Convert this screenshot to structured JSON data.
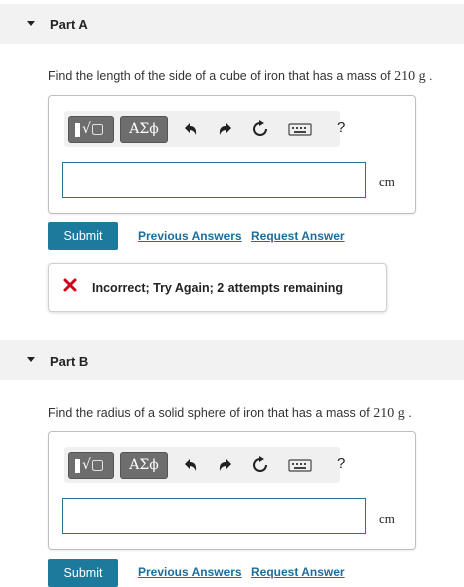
{
  "part_a": {
    "label": "Part A",
    "question_text": "Find the length of the side of a cube of iron that has a mass of",
    "mass": "210 g",
    "end": ".",
    "toolbar": {
      "math_button": "√▢",
      "greek_button": "ΑΣϕ",
      "help": "?"
    },
    "unit": "cm",
    "submit_label": "Submit",
    "previous_answers": "Previous Answers",
    "request_answer": "Request Answer",
    "feedback": "Incorrect; Try Again; 2 attempts remaining"
  },
  "part_b": {
    "label": "Part B",
    "question_text": "Find the radius of a solid sphere of iron that has a mass of",
    "mass": "210 g",
    "end": ".",
    "toolbar": {
      "math_button": "√▢",
      "greek_button": "ΑΣϕ",
      "help": "?"
    },
    "unit": "cm",
    "submit_label": "Submit",
    "previous_answers": "Previous Answers",
    "request_answer": "Request Answer"
  },
  "colors": {
    "accent": "#1c7a9c",
    "link": "#1c6e9c",
    "error": "#d0021b"
  },
  "icons": [
    "caret-down-icon",
    "undo-icon",
    "redo-icon",
    "reset-icon",
    "keyboard-icon",
    "help-icon",
    "error-x-icon"
  ]
}
